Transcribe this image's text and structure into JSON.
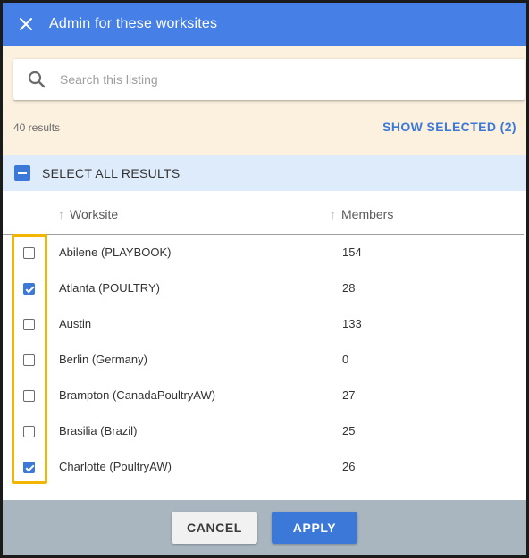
{
  "dialog": {
    "title": "Admin for these worksites"
  },
  "search": {
    "placeholder": "Search this listing",
    "value": ""
  },
  "summary": {
    "results_count": "40 results",
    "show_selected": "SHOW SELECTED (2)"
  },
  "select_all": {
    "label": "SELECT ALL RESULTS",
    "state": "indeterminate"
  },
  "table": {
    "columns": [
      "Worksite",
      "Members"
    ],
    "rows": [
      {
        "worksite": "Abilene (PLAYBOOK)",
        "members": "154",
        "checked": false
      },
      {
        "worksite": "Atlanta (POULTRY)",
        "members": "28",
        "checked": true
      },
      {
        "worksite": "Austin",
        "members": "133",
        "checked": false
      },
      {
        "worksite": "Berlin (Germany)",
        "members": "0",
        "checked": false
      },
      {
        "worksite": "Brampton (CanadaPoultryAW)",
        "members": "27",
        "checked": false
      },
      {
        "worksite": "Brasilia (Brazil)",
        "members": "25",
        "checked": false
      },
      {
        "worksite": "Charlotte (PoultryAW)",
        "members": "26",
        "checked": true
      }
    ]
  },
  "footer": {
    "cancel_label": "CANCEL",
    "apply_label": "APPLY"
  },
  "colors": {
    "header_bg": "#4680e6",
    "accent": "#3b78d8",
    "search_zone_bg": "#fcf0df",
    "select_all_bg": "#ddebfb",
    "footer_bg": "#a9b5bf",
    "highlight": "#f2b600"
  }
}
